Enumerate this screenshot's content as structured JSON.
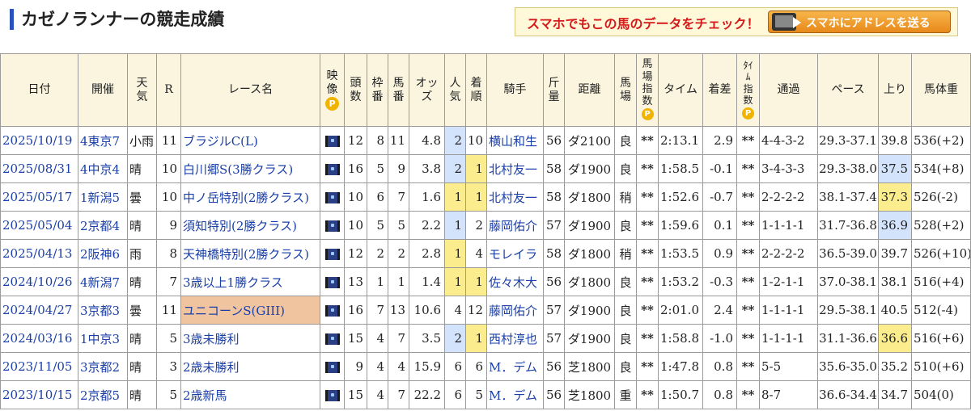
{
  "page": {
    "title": "カゼノランナーの競走成績",
    "smartphone_promo": "スマホでもこの馬のデータをチェック！",
    "smartphone_button": "スマホにアドレスを送る"
  },
  "colors": {
    "accent": "#2a52be",
    "header_bg": "#fbf5e0",
    "link": "#1a3fa8",
    "highlight_blue": "#d2e3fb",
    "highlight_yellow": "#fbec8e",
    "grade_race": "#f1c4a0",
    "promo_text": "#d41a1a"
  },
  "table": {
    "headers": {
      "date": "日付",
      "venue": "開催",
      "weather": "天気",
      "race_no": "R",
      "race_name": "レース名",
      "video": "映像",
      "field_size": "頭数",
      "gate": "枠番",
      "horse_no": "馬番",
      "odds": "オッズ",
      "popularity": "人気",
      "finish": "着順",
      "jockey": "騎手",
      "weight_carried": "斤量",
      "distance": "距離",
      "track": "馬場",
      "track_index": "馬場指数",
      "time": "タイム",
      "margin": "着差",
      "time_index": "ﾀｲﾑ指数",
      "passing": "通過",
      "pace": "ペース",
      "last3f": "上り",
      "body_weight": "馬体重",
      "premium_badge": "P"
    },
    "rows": [
      {
        "date": "2025/10/19",
        "venue": "4東京7",
        "weather": "小雨",
        "race_no": "11",
        "race_name": "ブラジルC(L)",
        "video_icon": "video-icon",
        "field_size": "12",
        "gate": "8",
        "horse_no": "11",
        "odds": "4.8",
        "popularity": "2",
        "finish": "10",
        "jockey": "横山和生",
        "weight_carried": "56",
        "distance": "ダ2100",
        "track": "良",
        "track_index": "**",
        "time": "2:13.1",
        "margin": "2.9",
        "time_index": "**",
        "passing": "4-4-3-2",
        "pace": "29.3-37.1",
        "last3f": "39.8",
        "body_weight": "536(+2)"
      },
      {
        "date": "2025/08/31",
        "venue": "4中京4",
        "weather": "晴",
        "race_no": "10",
        "race_name": "白川郷S(3勝クラス)",
        "video_icon": "video-icon",
        "field_size": "16",
        "gate": "5",
        "horse_no": "9",
        "odds": "3.8",
        "popularity": "2",
        "finish": "1",
        "jockey": "北村友一",
        "weight_carried": "58",
        "distance": "ダ1900",
        "track": "良",
        "track_index": "**",
        "time": "1:58.5",
        "margin": "-0.1",
        "time_index": "**",
        "passing": "3-4-3-3",
        "pace": "29.3-38.0",
        "last3f": "37.5",
        "body_weight": "534(+8)"
      },
      {
        "date": "2025/05/17",
        "venue": "1新潟5",
        "weather": "曇",
        "race_no": "10",
        "race_name": "中ノ岳特別(2勝クラス)",
        "video_icon": "video-icon",
        "field_size": "10",
        "gate": "6",
        "horse_no": "7",
        "odds": "1.6",
        "popularity": "1",
        "finish": "1",
        "jockey": "北村友一",
        "weight_carried": "58",
        "distance": "ダ1800",
        "track": "稍",
        "track_index": "**",
        "time": "1:52.6",
        "margin": "-0.7",
        "time_index": "**",
        "passing": "2-2-2-2",
        "pace": "38.1-37.4",
        "last3f": "37.3",
        "body_weight": "526(-2)"
      },
      {
        "date": "2025/05/04",
        "venue": "2京都4",
        "weather": "晴",
        "race_no": "9",
        "race_name": "須知特別(2勝クラス)",
        "video_icon": "video-icon",
        "field_size": "10",
        "gate": "5",
        "horse_no": "5",
        "odds": "2.2",
        "popularity": "1",
        "finish": "2",
        "jockey": "藤岡佑介",
        "weight_carried": "57",
        "distance": "ダ1900",
        "track": "良",
        "track_index": "**",
        "time": "1:59.6",
        "margin": "0.1",
        "time_index": "**",
        "passing": "1-1-1-1",
        "pace": "31.7-36.8",
        "last3f": "36.9",
        "body_weight": "528(+2)"
      },
      {
        "date": "2025/04/13",
        "venue": "2阪神6",
        "weather": "雨",
        "race_no": "8",
        "race_name": "天神橋特別(2勝クラス)",
        "video_icon": "video-icon",
        "field_size": "12",
        "gate": "2",
        "horse_no": "2",
        "odds": "2.8",
        "popularity": "1",
        "finish": "4",
        "jockey": "モレイラ",
        "weight_carried": "58",
        "distance": "ダ1800",
        "track": "稍",
        "track_index": "**",
        "time": "1:53.5",
        "margin": "0.9",
        "time_index": "**",
        "passing": "2-2-2-2",
        "pace": "36.5-39.0",
        "last3f": "39.7",
        "body_weight": "526(+10)"
      },
      {
        "date": "2024/10/26",
        "venue": "4新潟7",
        "weather": "晴",
        "race_no": "7",
        "race_name": "3歳以上1勝クラス",
        "video_icon": "video-icon",
        "field_size": "13",
        "gate": "1",
        "horse_no": "1",
        "odds": "1.4",
        "popularity": "1",
        "finish": "1",
        "jockey": "佐々木大",
        "weight_carried": "56",
        "distance": "ダ1800",
        "track": "良",
        "track_index": "**",
        "time": "1:53.2",
        "margin": "-0.3",
        "time_index": "**",
        "passing": "1-2-1-1",
        "pace": "37.0-38.1",
        "last3f": "38.1",
        "body_weight": "516(+4)"
      },
      {
        "date": "2024/04/27",
        "venue": "3京都3",
        "weather": "曇",
        "race_no": "11",
        "race_name": "ユニコーンS(GIII)",
        "video_icon": "video-icon",
        "field_size": "16",
        "gate": "7",
        "horse_no": "13",
        "odds": "10.6",
        "popularity": "4",
        "finish": "12",
        "jockey": "藤岡佑介",
        "weight_carried": "57",
        "distance": "ダ1900",
        "track": "良",
        "track_index": "**",
        "time": "2:01.0",
        "margin": "2.4",
        "time_index": "**",
        "passing": "1-1-1-1",
        "pace": "29.5-38.1",
        "last3f": "40.5",
        "body_weight": "512(-4)"
      },
      {
        "date": "2024/03/16",
        "venue": "1中京3",
        "weather": "晴",
        "race_no": "5",
        "race_name": "3歳未勝利",
        "video_icon": "video-icon",
        "field_size": "15",
        "gate": "4",
        "horse_no": "7",
        "odds": "3.5",
        "popularity": "2",
        "finish": "1",
        "jockey": "西村淳也",
        "weight_carried": "57",
        "distance": "ダ1900",
        "track": "良",
        "track_index": "**",
        "time": "1:58.8",
        "margin": "-1.0",
        "time_index": "**",
        "passing": "1-1-1-1",
        "pace": "31.1-36.6",
        "last3f": "36.6",
        "body_weight": "516(+6)"
      },
      {
        "date": "2023/11/05",
        "venue": "3京都2",
        "weather": "晴",
        "race_no": "3",
        "race_name": "2歳未勝利",
        "video_icon": "video-icon",
        "field_size": "9",
        "gate": "4",
        "horse_no": "4",
        "odds": "15.9",
        "popularity": "6",
        "finish": "6",
        "jockey": "M．デム",
        "weight_carried": "56",
        "distance": "芝1800",
        "track": "良",
        "track_index": "**",
        "time": "1:47.8",
        "margin": "0.8",
        "time_index": "**",
        "passing": "5-5",
        "pace": "35.6-35.0",
        "last3f": "35.2",
        "body_weight": "510(+6)"
      },
      {
        "date": "2023/10/15",
        "venue": "2京都5",
        "weather": "晴",
        "race_no": "5",
        "race_name": "2歳新馬",
        "video_icon": "video-icon",
        "field_size": "15",
        "gate": "4",
        "horse_no": "7",
        "odds": "22.2",
        "popularity": "6",
        "finish": "5",
        "jockey": "M．デム",
        "weight_carried": "56",
        "distance": "芝1800",
        "track": "重",
        "track_index": "**",
        "time": "1:50.7",
        "margin": "0.8",
        "time_index": "**",
        "passing": "8-7",
        "pace": "36.6-34.4",
        "last3f": "34.7",
        "body_weight": "504(0)"
      }
    ],
    "highlights": {
      "popularity_blue_rows": [
        0,
        1,
        3,
        7
      ],
      "popularity_yellow_rows": [
        2,
        4,
        5
      ],
      "finish_yellow_rows": [
        1,
        2,
        5,
        7
      ],
      "last3f_blue_rows": [
        1,
        3
      ],
      "last3f_yellow_rows": [
        2,
        7
      ],
      "grade_race_rows": [
        6
      ]
    }
  }
}
